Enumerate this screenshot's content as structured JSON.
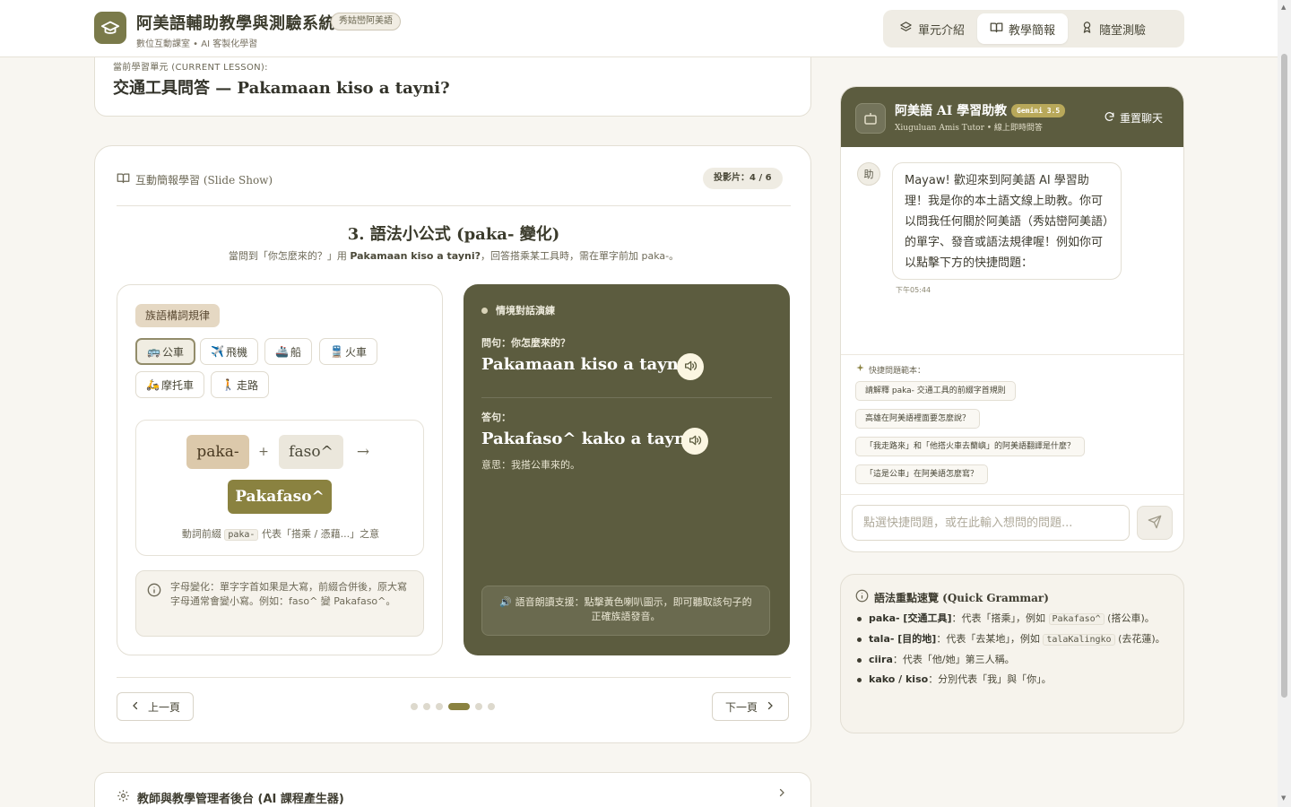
{
  "header": {
    "title": "阿美語輔助教學與測驗系統",
    "badge": "秀姑巒阿美語",
    "subtitle": "數位互動課室 • AI 客製化學習",
    "nav": [
      {
        "label": "單元介紹",
        "icon": "layers-icon"
      },
      {
        "label": "教學簡報",
        "icon": "book-icon",
        "active": true
      },
      {
        "label": "隨堂測驗",
        "icon": "award-icon"
      }
    ]
  },
  "lesson": {
    "label": "當前學習單元 (CURRENT LESSON):",
    "title": "交通工具問答 — Pakamaan kiso a tayni?"
  },
  "slide": {
    "section_label": "互動簡報學習 (Slide Show)",
    "counter": "投影片：4 / 6",
    "heading": "3. 語法小公式 (paka- 變化)",
    "desc_prefix": "當問到「你怎麼來的？」用 ",
    "desc_bold": "Pakamaan kiso a tayni?",
    "desc_suffix": "，回答搭乘某工具時，需在單字前加 paka-。",
    "rule_tag": "族語構詞規律",
    "vehicles": [
      {
        "emoji": "🚌",
        "label": "公車",
        "active": true
      },
      {
        "emoji": "✈️",
        "label": "飛機"
      },
      {
        "emoji": "🚢",
        "label": "船"
      },
      {
        "emoji": "🚆",
        "label": "火車"
      },
      {
        "emoji": "🛵",
        "label": "摩托車"
      },
      {
        "emoji": "🚶",
        "label": "走路"
      }
    ],
    "formula": {
      "prefix": "paka-",
      "plus": "+",
      "root": "faso^",
      "arrow": "→",
      "result": "Pakafaso^",
      "note_prefix": "動詞前綴 ",
      "note_code": "paka-",
      "note_suffix": " 代表「搭乘 / 憑藉...」之意"
    },
    "info_text": "字母變化：單字字首如果是大寫，前綴合併後，原大寫字母通常會變小寫。例如：faso^ 變 Pakafaso^。",
    "dialog": {
      "title": "情境對話演練",
      "q_label": "問句：你怎麼來的？",
      "q_text": "Pakamaan kiso a tayni?",
      "a_label": "答句：",
      "a_text": "Pakafaso^ kako a tayni.",
      "a_meaning": "意思：我搭公車來的。",
      "audio_note": "🔊 語音朗讀支援：點擊黃色喇叭圖示，即可聽取該句子的正確族語發音。"
    },
    "pager": {
      "prev": "上一頁",
      "next": "下一頁",
      "total": 6,
      "current": 4
    }
  },
  "admin": {
    "label": "教師與教學管理者後台 (AI 課程產生器)"
  },
  "chat": {
    "title": "阿美語 AI 學習助教",
    "model_badge": "Gemini 3.5",
    "subtitle": "Xiuguluan Amis Tutor • 線上即時問答",
    "reset": "重置聊天",
    "avatar": "助",
    "message": "Mayaw! 歡迎來到阿美語 AI 學習助理！我是你的本土語文線上助教。你可以問我任何關於阿美語（秀姑巒阿美語）的單字、發音或語法規律喔！例如你可以點擊下方的快捷問題：",
    "time": "下午05:44",
    "quick_label": "快捷問題範本：",
    "quick": [
      "請解釋 paka- 交通工具的前綴字首規則",
      "高雄在阿美語裡面要怎麼說？",
      "「我走路來」和「他搭火車去蘭嶼」的阿美語翻譯是什麼？",
      "「這是公車」在阿美語怎麼寫？"
    ],
    "input_placeholder": "點選快捷問題，或在此輸入想問的問題..."
  },
  "grammar": {
    "title": "語法重點速覽 (Quick Grammar)",
    "items": [
      {
        "bold": "paka- [交通工具]",
        "text1": "：代表「搭乘」，例如 ",
        "code": "Pakafaso^",
        "text2": " (搭公車)。"
      },
      {
        "bold": "tala- [目的地]",
        "text1": "：代表「去某地」，例如 ",
        "code": "talaKalingko",
        "text2": " (去花蓮)。"
      },
      {
        "bold": "ciira",
        "text1": "：代表「他/她」第三人稱。",
        "code": "",
        "text2": ""
      },
      {
        "bold": "kako / kiso",
        "text1": "：分別代表「我」與「你」。",
        "code": "",
        "text2": ""
      }
    ]
  },
  "colors": {
    "olive": "#5c5c3f",
    "accent": "#8a8240",
    "background": "#f8f6f1"
  }
}
